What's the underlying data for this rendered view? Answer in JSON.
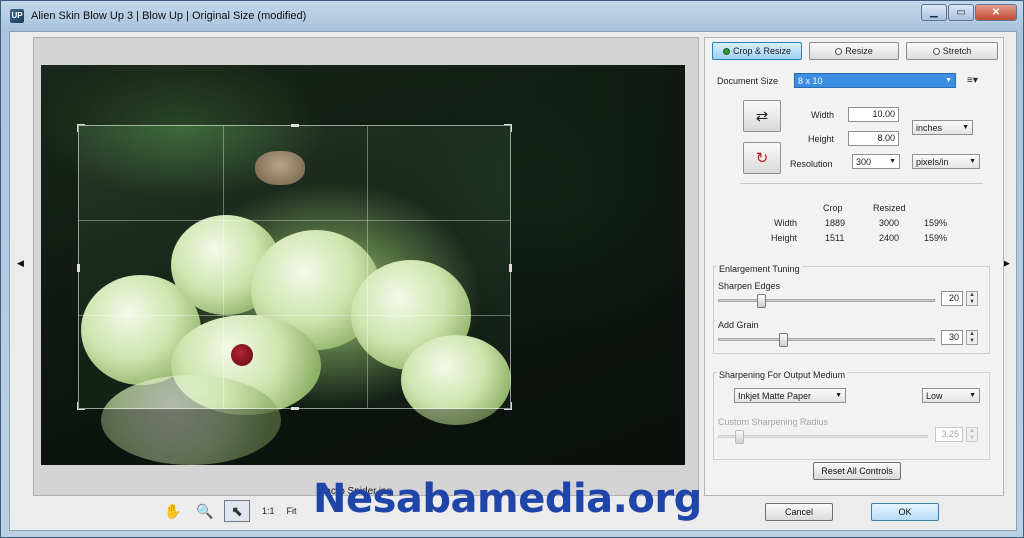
{
  "window": {
    "title": "Alien Skin Blow Up 3 | Blow Up | Original Size (modified)",
    "app_icon_text": "UP",
    "controls": {
      "minimize": "▁",
      "maximize": "▭",
      "close": "✕"
    }
  },
  "preview": {
    "filename": "Macro Spider.jpg",
    "left_arrow": "◀",
    "right_arrow": "▶"
  },
  "toolbar": {
    "tools": [
      {
        "name": "hand-tool",
        "icon": "hand-icon",
        "glyph": "✋"
      },
      {
        "name": "zoom-tool",
        "icon": "magnifier-icon",
        "glyph": "🔍"
      },
      {
        "name": "crop-select-tool",
        "icon": "arrow-select-icon",
        "glyph": "⬉"
      }
    ],
    "one_to_one": "1:1",
    "fit": "Fit"
  },
  "modes": {
    "crop_resize": "Crop & Resize",
    "resize": "Resize",
    "stretch": "Stretch",
    "active": "crop_resize"
  },
  "document": {
    "size_label": "Document Size",
    "size_value": "8 x 10",
    "menu_icon": "≡▾",
    "width_label": "Width",
    "width_value": "10.00",
    "height_label": "Height",
    "height_value": "8.00",
    "units_value": "inches",
    "resolution_label": "Resolution",
    "resolution_value": "300",
    "res_units_value": "pixels/in"
  },
  "stats": {
    "crop_header": "Crop",
    "resized_header": "Resized",
    "rows": [
      {
        "label": "Width",
        "crop": "1889",
        "resized": "3000",
        "percent": "159%"
      },
      {
        "label": "Height",
        "crop": "1511",
        "resized": "2400",
        "percent": "159%"
      }
    ]
  },
  "tuning": {
    "title": "Enlargement Tuning",
    "sharpen_label": "Sharpen Edges",
    "sharpen_value": "20",
    "sharpen_level": 0.2,
    "grain_label": "Add Grain",
    "grain_value": "30",
    "grain_level": 0.3
  },
  "output": {
    "title": "Sharpening For Output Medium",
    "medium_value": "Inkjet Matte Paper",
    "strength_value": "Low",
    "radius_label": "Custom Sharpening Radius",
    "radius_value": "3.25",
    "radius_level": 0.1
  },
  "buttons": {
    "reset": "Reset All Controls",
    "cancel": "Cancel",
    "ok": "OK"
  },
  "watermark": "Nesabamedia.org"
}
